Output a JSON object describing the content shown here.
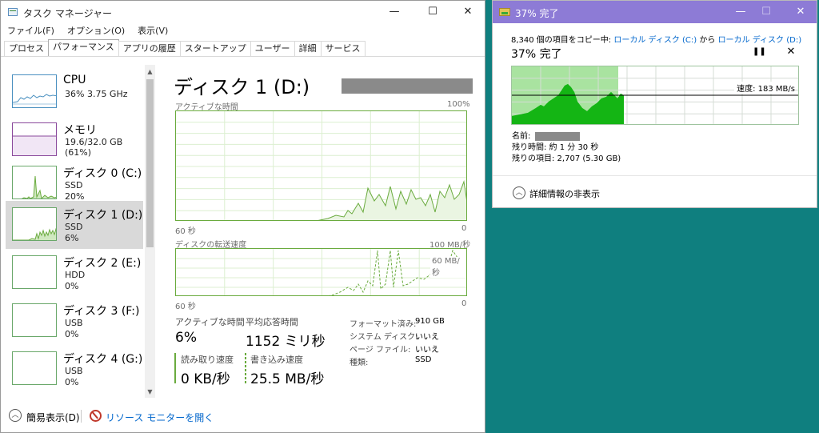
{
  "taskmgr": {
    "title": "タスク マネージャー",
    "menu": [
      "ファイル(F)",
      "オプション(O)",
      "表示(V)"
    ],
    "tabs": [
      "プロセス",
      "パフォーマンス",
      "アプリの履歴",
      "スタートアップ",
      "ユーザー",
      "詳細",
      "サービス"
    ],
    "active_tab_index": 1,
    "sidebar": [
      {
        "name": "CPU",
        "line1": "36%  3.75 GHz",
        "line2": "",
        "color": "#4a90c0"
      },
      {
        "name": "メモリ",
        "line1": "19.6/32.0 GB (61%)",
        "line2": "",
        "color": "#8b4a9c"
      },
      {
        "name": "ディスク 0 (C:)",
        "line1": "SSD",
        "line2": "20%",
        "color": "#6aab3e"
      },
      {
        "name": "ディスク 1 (D:)",
        "line1": "SSD",
        "line2": "6%",
        "color": "#6aab3e",
        "selected": true
      },
      {
        "name": "ディスク 2 (E:)",
        "line1": "HDD",
        "line2": "0%",
        "color": "#6aab3e"
      },
      {
        "name": "ディスク 3 (F:)",
        "line1": "USB",
        "line2": "0%",
        "color": "#6aab3e"
      },
      {
        "name": "ディスク 4 (G:)",
        "line1": "USB",
        "line2": "0%",
        "color": "#6aab3e"
      }
    ],
    "detail": {
      "title": "ディスク 1 (D:)",
      "graph1": {
        "label": "アクティブな時間",
        "max": "100%",
        "xlabel": "60 秒",
        "min": "0"
      },
      "graph2": {
        "label": "ディスクの転送速度",
        "max": "100 MB/秒",
        "mid": "60 MB/秒",
        "xlabel": "60 秒",
        "min": "0"
      },
      "active_time_label": "アクティブな時間",
      "active_time_value": "6%",
      "avg_response_label": "平均応答時間",
      "avg_response_value": "1152 ミリ秒",
      "read_label": "読み取り速度",
      "read_value": "0 KB/秒",
      "write_label": "書き込み速度",
      "write_value": "25.5 MB/秒",
      "props": [
        {
          "k": "フォーマット済み:",
          "v": "910 GB"
        },
        {
          "k": "システム ディスク:",
          "v": "いいえ"
        },
        {
          "k": "ページ ファイル:",
          "v": "いいえ"
        },
        {
          "k": "種類:",
          "v": "SSD"
        }
      ]
    },
    "footer": {
      "fewer_details": "簡易表示(D)",
      "resource_monitor": "リソース モニターを開く"
    }
  },
  "copy": {
    "title": "37% 完了",
    "line_prefix": "8,340 個の項目をコピー中:",
    "from": "ローカル ディスク (C:)",
    "mid": "から",
    "to": "ローカル ディスク (D:)",
    "percent_text": "37% 完了",
    "progress": 0.37,
    "speed": "速度: 183 MB/s",
    "name_label": "名前:",
    "time_left": "残り時間:  約 1 分 30 秒",
    "items_left": "残りの項目:  2,707 (5.30 GB)",
    "less_details": "詳細情報の非表示"
  },
  "icons": {
    "min": "—",
    "max": "☐",
    "close": "✕",
    "pause": "❚❚",
    "cancel": "✕",
    "chev_up": "︿",
    "chev_down": "﹀",
    "scroll_up": "▲",
    "scroll_down": "▼"
  }
}
